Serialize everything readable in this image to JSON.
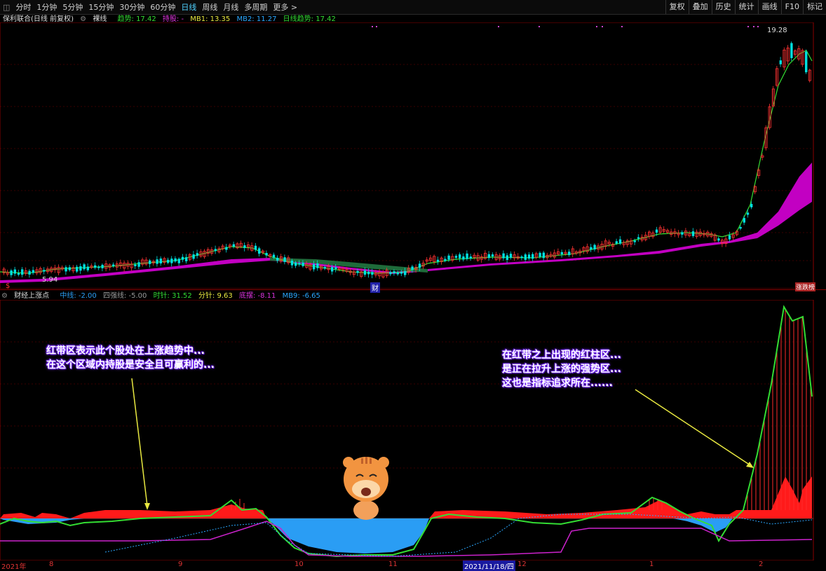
{
  "toolbar": {
    "items": [
      "分时",
      "1分钟",
      "5分钟",
      "15分钟",
      "30分钟",
      "60分钟",
      "日线",
      "周线",
      "月线",
      "多周期",
      "更多 >"
    ],
    "active": "日线",
    "right": [
      "复权",
      "叠加",
      "历史",
      "统计",
      "画线",
      "F10",
      "标记"
    ]
  },
  "main_legend": {
    "stock": "保利联合(日线 前复权)",
    "mode": "裸线",
    "trend_label": "趋势: 17.42",
    "hold_label": "持股: -",
    "mb1": "MB1: 13.35",
    "mb2": "MB2: 11.27",
    "daily": "日线趋势: 17.42"
  },
  "price_labels": {
    "high": "19.28",
    "low": "5.94"
  },
  "marker_fin": "财",
  "marker_right": "涨跌榜",
  "sub_legend": {
    "name": "财经上涨点",
    "mid": "中线: -2.00",
    "weak": "四强线: -5.00",
    "hour": "时针: 31.52",
    "minute": "分针: 9.63",
    "bottom": "底摆: -8.11",
    "mb9": "MB9: -6.65"
  },
  "annotations": {
    "left": [
      "红带区表示此个股处在上涨趋势中...",
      "在这个区域内持股是安全且可赢利的..."
    ],
    "right": [
      "在红带之上出现的红柱区...",
      "是正在拉升上涨的强势区...",
      "这也是指标追求所在......"
    ]
  },
  "axis": {
    "labels": [
      "2021年",
      "8",
      "9",
      "10",
      "11",
      "2021/11/18/四",
      "12",
      "1",
      "2"
    ]
  },
  "colors": {
    "up": "#ff3232",
    "down": "#00e0e0",
    "trend_band": "#cc00cc",
    "green_line": "#33dd33",
    "blue_fill": "#2a9df4",
    "red_fill": "#ff1a1a",
    "magenta": "#cc22cc"
  }
}
